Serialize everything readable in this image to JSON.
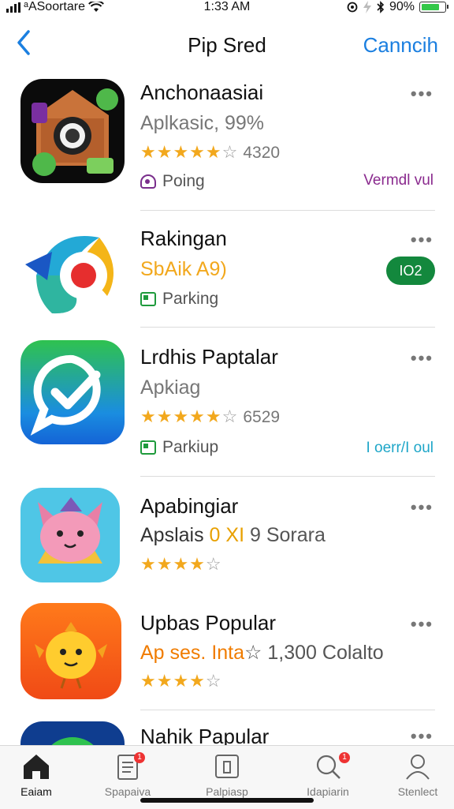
{
  "status": {
    "carrier": "ᵃASoortare",
    "time": "1:33 AM",
    "battery": "90%",
    "battery_level": 0.7
  },
  "nav": {
    "back_icon": "chevron-left-icon",
    "title": "Pip Sred",
    "action_label": "Canncih"
  },
  "apps": [
    {
      "name": "Anchonaasiai",
      "subtitle": "Aplkasic, 99%",
      "stars": "★★★★★",
      "empty_star": "☆",
      "rating_count": "4320",
      "tag": "Poing",
      "side_link": "Vermdl vul",
      "side_link_color": "#8a2a8e",
      "more": "•••"
    },
    {
      "name": "Rakingan",
      "subtitle": "SbAik A9)",
      "subtitle_color": "#f2a81d",
      "tag": "Parking",
      "button_label": "IO2",
      "more": "•••"
    },
    {
      "name": "Lrdhis Paptalar",
      "subtitle": "Apkiag",
      "stars": "★★★★★",
      "empty_star": "☆",
      "rating_count": "6529",
      "tag": "Parkiup",
      "side_link": "I oerr/I oul",
      "side_link_color": "#1ea6c8",
      "more": "•••"
    },
    {
      "name": "Apabingiar",
      "subtitle": "Apslais",
      "subtitle_mid": "0 XI",
      "subtitle_tail": "9 Sorara",
      "stars": "★★★★",
      "empty_star": "☆",
      "more": "•••"
    },
    {
      "name": "Upbas Popular",
      "subtitle": "Ap ses. Inta",
      "subtitle_color": "#f07c00",
      "subtitle_tail": "☆ 1,300  Colalto",
      "stars": "★★★★",
      "empty_star": "☆",
      "more": "•••"
    },
    {
      "name": "Nahik Papular",
      "more": "•••"
    }
  ],
  "tabs": [
    {
      "label": "Eaiam",
      "icon": "home-icon",
      "active": true
    },
    {
      "label": "Spapaiva",
      "icon": "document-icon",
      "badge": "1"
    },
    {
      "label": "Palpiasp",
      "icon": "mailbox-icon"
    },
    {
      "label": "Idapiarin",
      "icon": "search-icon",
      "badge": "1"
    },
    {
      "label": "Stenlect",
      "icon": "person-icon"
    }
  ]
}
